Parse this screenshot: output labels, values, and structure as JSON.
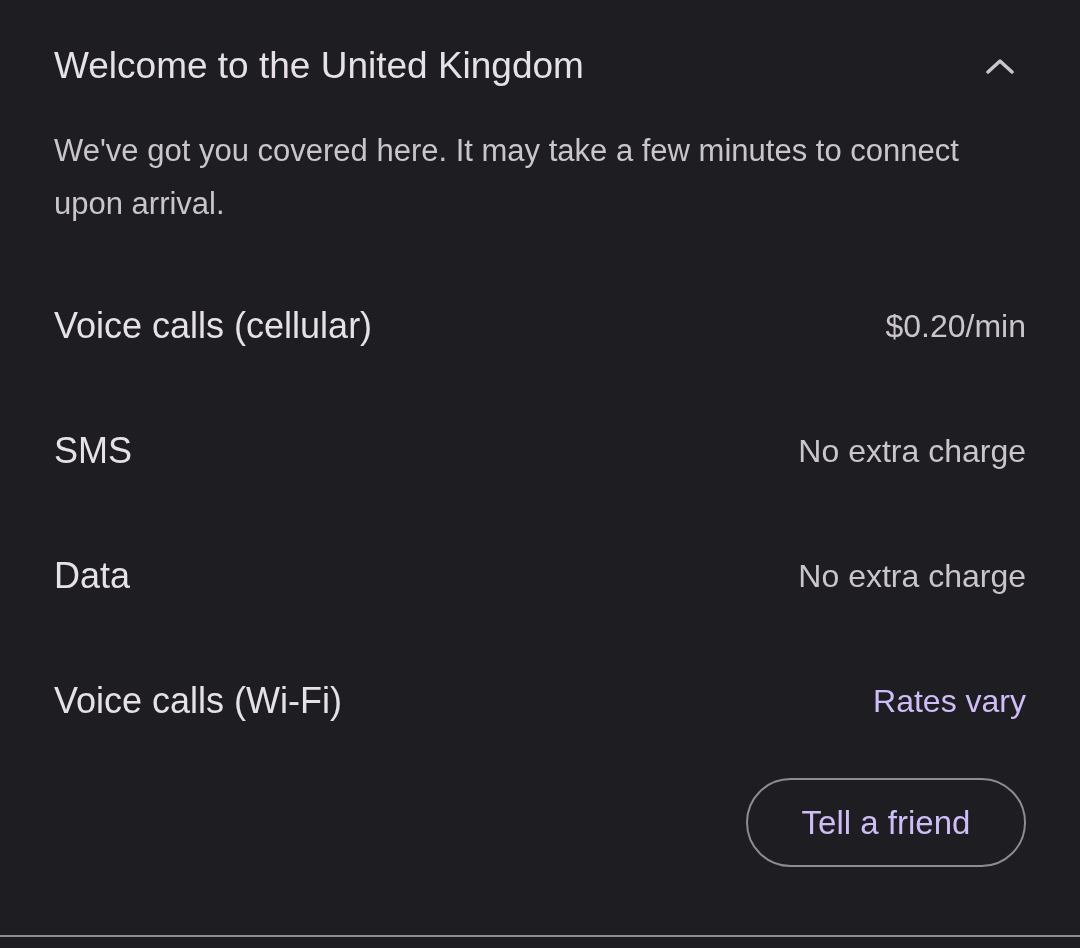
{
  "section": {
    "title": "Welcome to the United Kingdom",
    "expanded": true,
    "description": "We've got you covered here. It may take a few minutes to connect upon arrival."
  },
  "rates": [
    {
      "label": "Voice calls (cellular)",
      "value": "$0.20/min",
      "kind": "text"
    },
    {
      "label": "SMS",
      "value": "No extra charge",
      "kind": "text"
    },
    {
      "label": "Data",
      "value": "No extra charge",
      "kind": "text"
    },
    {
      "label": "Voice calls (Wi-Fi)",
      "value": "Rates vary",
      "kind": "link"
    }
  ],
  "button": {
    "label": "Tell a friend"
  }
}
